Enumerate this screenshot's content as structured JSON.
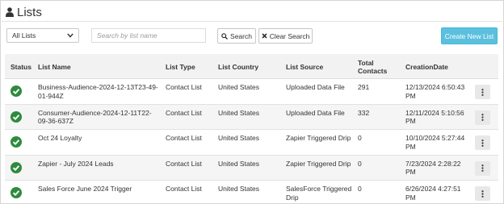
{
  "page": {
    "title": "Lists"
  },
  "toolbar": {
    "filter_selected": "All Lists",
    "search_placeholder": "Search by list name",
    "search_label": "Search",
    "clear_label": "Clear Search",
    "create_label": "Create New List"
  },
  "table": {
    "headers": {
      "status": "Status",
      "name": "List Name",
      "type": "List Type",
      "country": "List Country",
      "source": "List Source",
      "total": "Total Contacts",
      "date": "CreationDate"
    },
    "rows": [
      {
        "name": "Business-Audience-2024-12-13T23-49-01-944Z",
        "type": "Contact List",
        "country": "United States",
        "source": "Uploaded Data File",
        "total": "291",
        "date": "12/13/2024 6:50:43 PM"
      },
      {
        "name": "Consumer-Audience-2024-12-11T22-09-36-637Z",
        "type": "Contact List",
        "country": "United States",
        "source": "Uploaded Data File",
        "total": "332",
        "date": "12/11/2024 5:10:56 PM"
      },
      {
        "name": "Oct 24 Loyalty",
        "type": "Contact List",
        "country": "United States",
        "source": "Zapier Triggered Drip",
        "total": "0",
        "date": "10/10/2024 5:27:44 PM"
      },
      {
        "name": "Zapier - July 2024 Leads",
        "type": "Contact List",
        "country": "United States",
        "source": "Zapier Triggered Drip",
        "total": "0",
        "date": "7/23/2024 2:28:22 PM"
      },
      {
        "name": "Sales Force June 2024 Trigger",
        "type": "Contact List",
        "country": "United States",
        "source": "SalesForce Triggered Drip",
        "total": "0",
        "date": "6/26/2024 4:27:51 PM"
      }
    ]
  },
  "colors": {
    "accent": "#5bc0de",
    "status_ok": "#2e8b3d"
  },
  "icons": {
    "title": "user-icon",
    "search": "search-icon",
    "clear": "close-icon",
    "status": "check-circle-icon",
    "actions": "kebab-menu-icon"
  }
}
